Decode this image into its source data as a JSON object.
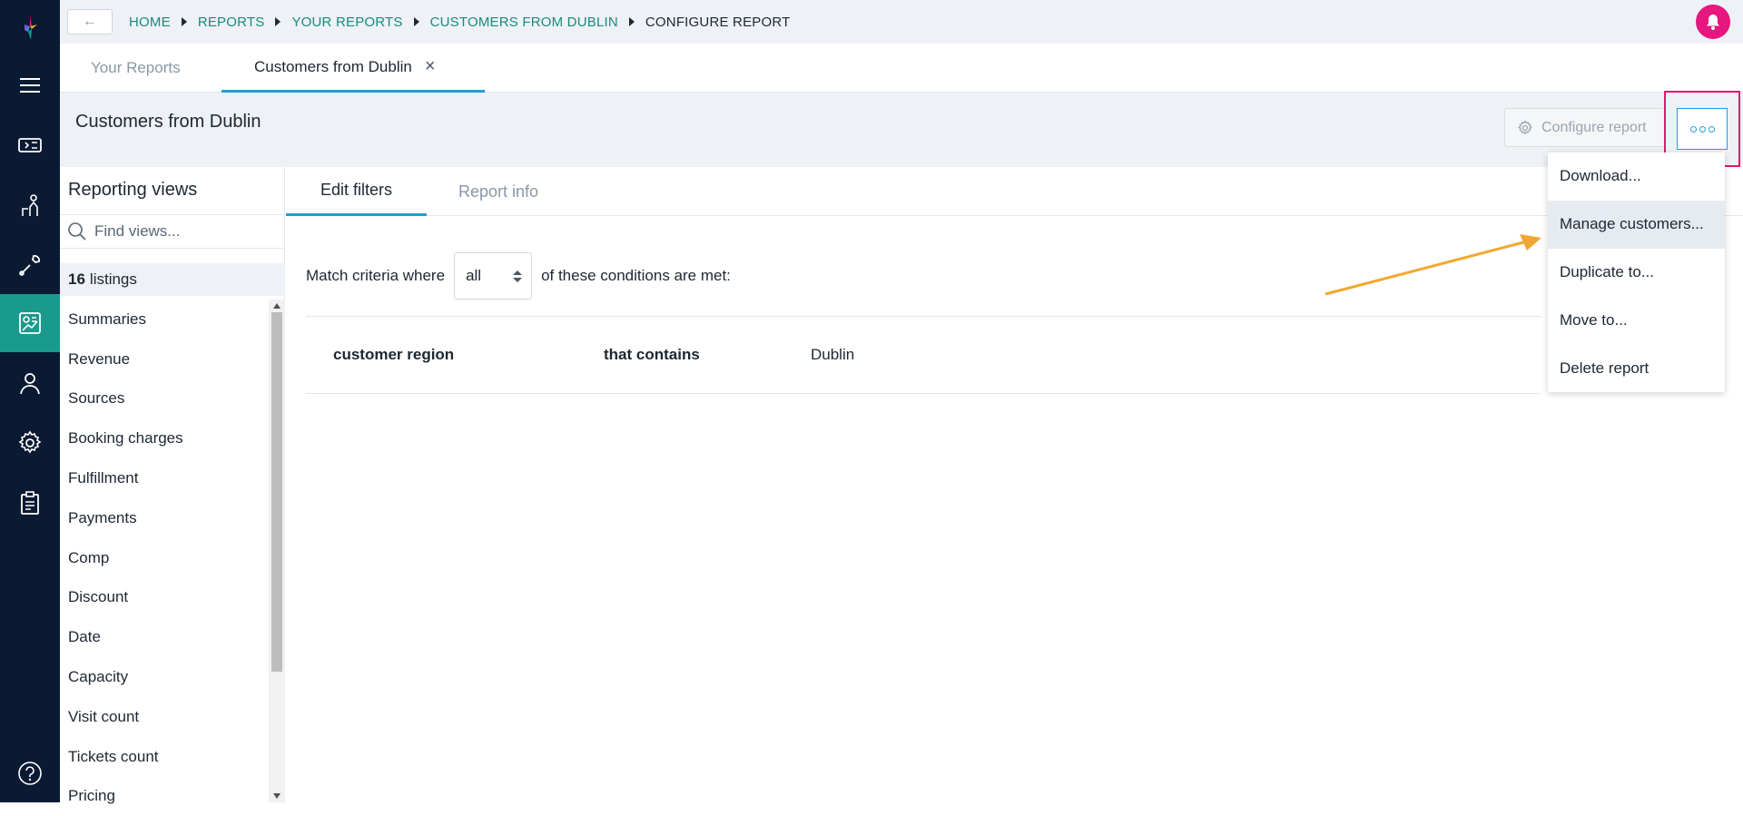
{
  "breadcrumb": {
    "items": [
      "HOME",
      "REPORTS",
      "YOUR REPORTS",
      "CUSTOMERS FROM DUBLIN"
    ],
    "current": "CONFIGURE REPORT"
  },
  "tabs": {
    "your_reports": "Your Reports",
    "open_report": "Customers from Dublin"
  },
  "header": {
    "title": "Customers from Dublin",
    "configure_label": "Configure report"
  },
  "views_panel": {
    "title": "Reporting views",
    "search_placeholder": "Find views...",
    "listings_count": "16",
    "listings_label": "listings",
    "items": [
      "Summaries",
      "Revenue",
      "Sources",
      "Booking charges",
      "Fulfillment",
      "Payments",
      "Comp",
      "Discount",
      "Date",
      "Capacity",
      "Visit count",
      "Tickets count",
      "Pricing"
    ]
  },
  "main_tabs": {
    "edit_filters": "Edit filters",
    "report_info": "Report info"
  },
  "criteria": {
    "prefix": "Match criteria where",
    "selected": "all",
    "suffix": "of these conditions are met:"
  },
  "condition": {
    "field": "customer region",
    "operator": "that contains",
    "value": "Dublin"
  },
  "menu": {
    "items": [
      "Download...",
      "Manage customers...",
      "Duplicate to...",
      "Move to...",
      "Delete report"
    ]
  },
  "colors": {
    "rail_bg": "#0b1a33",
    "accent_teal": "#1a9a8c",
    "accent_blue": "#1ea0d9",
    "brand_pink": "#e6177f",
    "annotation_arrow": "#f2a830"
  }
}
